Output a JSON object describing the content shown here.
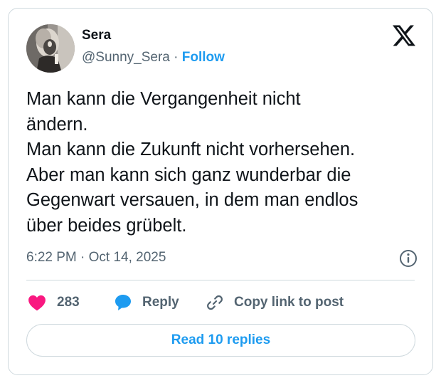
{
  "author": {
    "name": "Sera",
    "handle": "@Sunny_Sera",
    "separator": " · ",
    "follow_label": "Follow"
  },
  "tweet": {
    "text": "Man kann die Vergangenheit nicht\nändern.\nMan kann die Zukunft nicht vorhersehen.\nAber man kann sich ganz wunderbar die\nGegenwart versauen, in dem man endlos\nüber beides grübelt.",
    "timestamp": "6:22 PM · Oct 14, 2025"
  },
  "actions": {
    "likes": "283",
    "reply_label": "Reply",
    "copy_label": "Copy link to post"
  },
  "read_replies_label": "Read 10 replies",
  "colors": {
    "accent": "#1d9bf0",
    "like": "#f91880",
    "secondary_text": "#536471",
    "border": "#cfd9de"
  },
  "icons": {
    "brand": "x-logo-icon",
    "info": "info-icon",
    "like": "heart-icon",
    "reply": "speech-bubble-icon",
    "copy": "link-icon"
  }
}
